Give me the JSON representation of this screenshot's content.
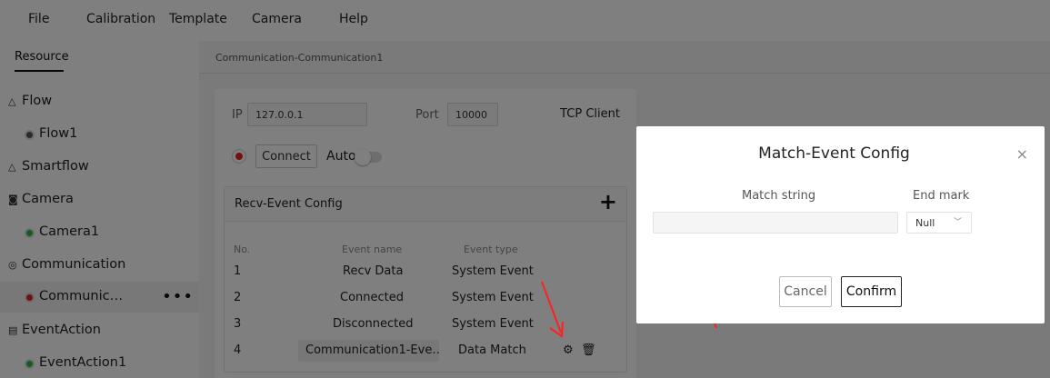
{
  "menubar": {
    "items": [
      "File",
      "Calibration",
      "Template",
      "Camera",
      "Help"
    ]
  },
  "sidebar": {
    "tab": "Resource",
    "items": [
      {
        "label": "Flow",
        "icon": "flow-icon"
      },
      {
        "label": "Flow1",
        "dot_color": "#555555"
      },
      {
        "label": "Smartflow",
        "icon": "flow-icon"
      },
      {
        "label": "Camera",
        "icon": "camera-icon"
      },
      {
        "label": "Camera1",
        "dot_color": "#2db84d"
      },
      {
        "label": "Communication",
        "icon": "communication-icon"
      },
      {
        "label": "Communic…",
        "dot_color": "#e02020",
        "more": "•••"
      },
      {
        "label": "EventAction",
        "icon": "event-icon"
      },
      {
        "label": "EventAction1",
        "dot_color": "#2db84d"
      }
    ]
  },
  "main": {
    "breadcrumb": "Communication-Communication1",
    "ip_label": "IP",
    "ip_value": "127.0.0.1",
    "port_label": "Port",
    "port_value": "10000",
    "mode": "TCP Client",
    "connect_label": "Connect",
    "auto_label": "Auto",
    "recv": {
      "title": "Recv-Event Config",
      "add_icon": "+",
      "headers": [
        "No.",
        "Event name",
        "Event type"
      ],
      "rows": [
        {
          "no": "1",
          "name": "Recv Data",
          "type": "System Event"
        },
        {
          "no": "2",
          "name": "Connected",
          "type": "System Event"
        },
        {
          "no": "3",
          "name": "Disconnected",
          "type": "System Event"
        },
        {
          "no": "4",
          "name": "Communication1-Eve…",
          "type": "Data Match"
        }
      ]
    }
  },
  "dialog": {
    "title": "Match-Event Config",
    "close": "×",
    "match_label": "Match string",
    "match_value": "",
    "endmark_label": "End mark",
    "endmark_value": "Null",
    "cancel": "Cancel",
    "confirm": "Confirm"
  },
  "colors": {
    "accent_red": "#e02020",
    "ok_green": "#2db84d",
    "annotation_red": "#ff2020"
  }
}
